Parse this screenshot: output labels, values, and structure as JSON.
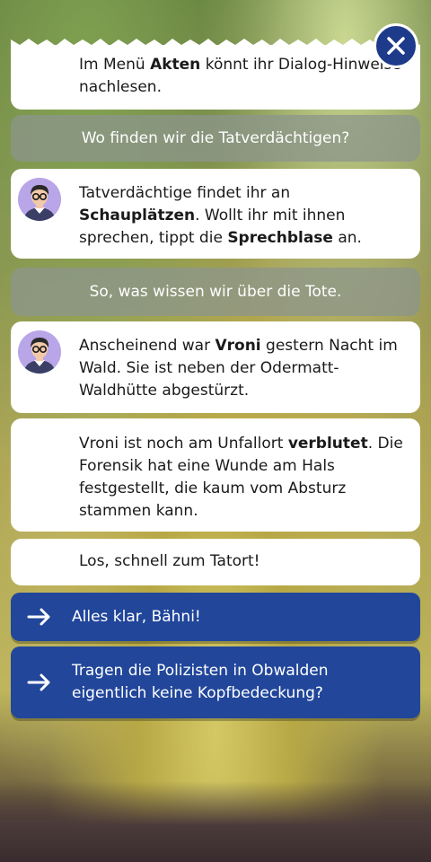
{
  "close": {
    "icon": "close-icon"
  },
  "messages": [
    {
      "type": "npc",
      "avatar": false,
      "text": "Im Menü Akten könnt ihr Dialog-Hinweise nachlesen."
    },
    {
      "type": "player",
      "text": "Wo finden wir die Tatverdächtigen?"
    },
    {
      "type": "npc",
      "avatar": true,
      "text": "Tatverdächtige findet ihr an Schauplätzen. Wollt ihr mit ihnen sprechen, tippt die Sprechblase an."
    },
    {
      "type": "player",
      "text": "So, was wissen wir über die Tote."
    },
    {
      "type": "npc",
      "avatar": true,
      "text": "Anscheinend war Vroni gestern Nacht im Wald. Sie ist neben der Odermatt-Waldhütte abgestürzt."
    },
    {
      "type": "npc",
      "avatar": false,
      "text": "Vroni ist noch am Unfallort verblutet. Die Forensik hat eine Wunde am Hals festgestellt, die kaum vom Absturz stammen kann."
    },
    {
      "type": "npc",
      "avatar": false,
      "text": "Los, schnell zum Tatort!"
    }
  ],
  "msg0": {
    "a": "Im Menü ",
    "b": "Akten",
    "c": " könnt ihr Dialog-Hinweise nachlesen."
  },
  "msg2": {
    "a": "Tatverdächtige findet ihr an ",
    "b": "Schauplätzen",
    "c": ". Wollt ihr mit ihnen sprechen, tippt die ",
    "d": "Sprechblase",
    "e": " an."
  },
  "msg4": {
    "a": "Anscheinend war ",
    "b": "Vroni",
    "c": " gestern Nacht im Wald. Sie ist neben der Odermatt-Waldhütte abgestürzt."
  },
  "msg5": {
    "a": "Vroni ist noch am Unfallort ",
    "b": "verblutet",
    "c": ". Die Forensik hat eine Wunde am Hals festgestellt, die kaum vom Absturz stammen kann."
  },
  "choices": [
    {
      "label": "Alles klar, Bähni!",
      "icon": "arrow-right-icon"
    },
    {
      "label": "Tragen die Polizisten in Obwalden eigentlich keine Kopfbedeckung?",
      "icon": "arrow-right-icon"
    }
  ],
  "colors": {
    "choice_bg": "#21469a",
    "close_bg": "#1e3a8a",
    "avatar_bg": "#b9a6e8"
  }
}
